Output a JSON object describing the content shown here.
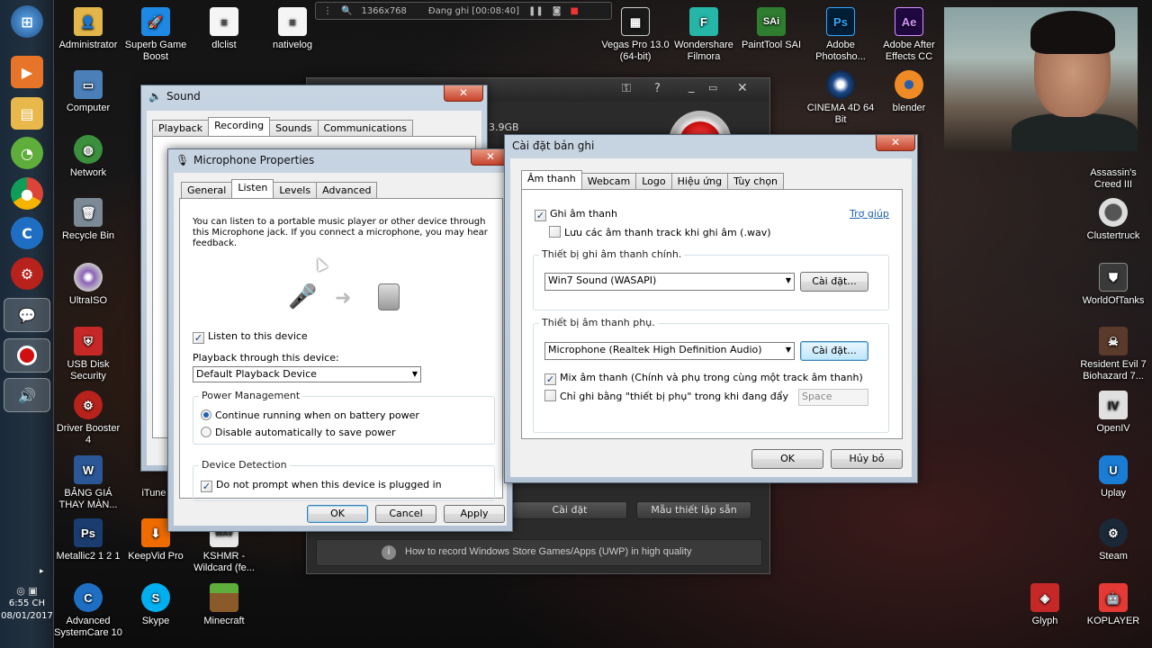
{
  "taskbar": {
    "clock_time": "6:55 CH",
    "clock_date": "08/01/2017"
  },
  "recording_bar": {
    "resolution": "1366x768",
    "status": "Đang ghi [00:08:40]"
  },
  "desktop_left": [
    {
      "label": "Administrator"
    },
    {
      "label": "Computer"
    },
    {
      "label": "Network"
    },
    {
      "label": "Recycle Bin"
    },
    {
      "label": "UltraISO"
    },
    {
      "label": "USB Disk Security"
    },
    {
      "label": "Driver Booster 4"
    },
    {
      "label": "BẢNG GIÁ THAY MÀN..."
    },
    {
      "label": "Metallic2 1 2 1"
    },
    {
      "label": "Advanced SystemCare 10"
    }
  ],
  "desktop_col2": [
    {
      "label": "Superb Game Boost"
    },
    {
      "label": "iTune"
    },
    {
      "label": "KeepVid Pro"
    },
    {
      "label": "Skype"
    }
  ],
  "desktop_col3": [
    {
      "label": "dlclist"
    },
    {
      "label": "KSHMR - Wildcard (fe..."
    },
    {
      "label": "Minecraft"
    }
  ],
  "desktop_col4": [
    {
      "label": "nativelog"
    }
  ],
  "desktop_top_right": [
    {
      "label": "Vegas Pro 13.0 (64-bit)"
    },
    {
      "label": "Wondershare Filmora"
    },
    {
      "label": "PaintTool SAI"
    },
    {
      "label": "Adobe Photosho..."
    },
    {
      "label": "Adobe After Effects CC"
    }
  ],
  "desktop_row2": [
    {
      "label": "CINEMA 4D 64 Bit"
    },
    {
      "label": "blender"
    }
  ],
  "desktop_right": [
    {
      "label": "Assassin's Creed III"
    },
    {
      "label": "Clustertruck"
    },
    {
      "label": "WorldOfTanks"
    },
    {
      "label": "Resident Evil 7 Biohazard 7..."
    },
    {
      "label": "OpenIV"
    },
    {
      "label": "Uplay"
    },
    {
      "label": "Steam"
    },
    {
      "label": "KOPLAYER"
    },
    {
      "label": "Glyph"
    }
  ],
  "sound_window": {
    "title": "Sound",
    "tabs": [
      "Playback",
      "Recording",
      "Sounds",
      "Communications"
    ]
  },
  "mic_window": {
    "title": "Microphone Properties",
    "tabs": [
      "General",
      "Listen",
      "Levels",
      "Advanced"
    ],
    "description": "You can listen to a portable music player or other device through this Microphone jack.  If you connect a microphone, you may hear feedback.",
    "listen_checkbox": "Listen to this device",
    "playback_label": "Playback through this device:",
    "playback_value": "Default Playback Device",
    "power_group": "Power Management",
    "power_opt1": "Continue running when on battery power",
    "power_opt2": "Disable automatically to save power",
    "detect_group": "Device Detection",
    "detect_checkbox": "Do not prompt when this device is plugged in",
    "ok": "OK",
    "cancel": "Cancel",
    "apply": "Apply"
  },
  "recorder": {
    "size_text": "3.9GB",
    "btn_settings": "Cài đặt",
    "btn_presets": "Mẫu thiết lập sẵn",
    "tip": "How to record Windows Store Games/Apps (UWP) in high quality"
  },
  "settings_window": {
    "title": "Cài đặt bản ghi",
    "tabs": [
      "Âm thanh",
      "Webcam",
      "Logo",
      "Hiệu ứng",
      "Tùy chọn"
    ],
    "help_link": "Trợ giúp",
    "record_audio": "Ghi âm thanh",
    "save_tracks": "Lưu các âm thanh track khi ghi âm (.wav)",
    "main_device_label": "Thiết bị ghi âm thanh chính.",
    "main_device_value": "Win7 Sound (WASAPI)",
    "main_settings_btn": "Cài đặt...",
    "sub_device_label": "Thiết bị âm thanh phụ.",
    "sub_device_value": "Microphone (Realtek High Definition Audio)",
    "sub_settings_btn": "Cài đặt...",
    "mix_label": "Mix âm thanh (Chính và phụ trong cùng một track âm thanh)",
    "push_label": "Chỉ ghi bằng \"thiết bị phụ\" trong khi đang đẩy",
    "push_key": "Space",
    "ok": "OK",
    "cancel": "Hủy bỏ"
  }
}
